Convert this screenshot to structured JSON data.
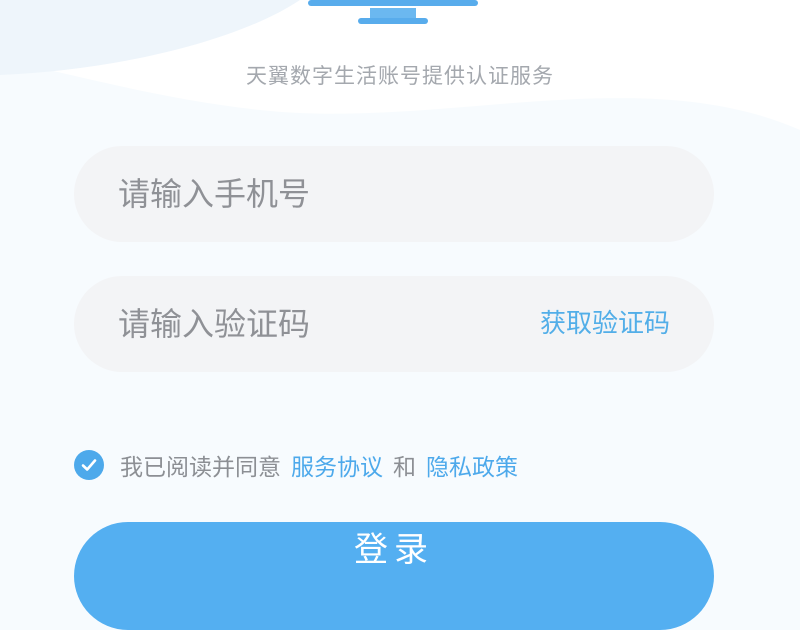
{
  "subtitle": "天翼数字生活账号提供认证服务",
  "form": {
    "phone_placeholder": "请输入手机号",
    "code_placeholder": "请输入验证码",
    "get_code_label": "获取验证码"
  },
  "agreement": {
    "prefix": "我已阅读并同意",
    "service_link": "服务协议",
    "conjunction": "和",
    "privacy_link": "隐私政策",
    "checked": true
  },
  "login_label": "登录",
  "colors": {
    "accent": "#4da9eb",
    "button": "#54aff1",
    "field_bg": "#f3f4f6",
    "placeholder": "#8f9196",
    "subtitle": "#a4a8ae"
  },
  "icons": {
    "logo": "monitor-icon",
    "check": "check-icon"
  }
}
